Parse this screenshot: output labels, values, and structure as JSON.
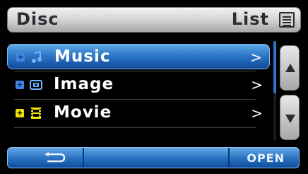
{
  "header": {
    "left_title": "Disc",
    "right_title": "List"
  },
  "list": {
    "items": [
      {
        "label": "Music",
        "icon": "music-note-icon",
        "chevron": ">",
        "selected": true
      },
      {
        "label": "Image",
        "icon": "image-icon",
        "chevron": ">",
        "selected": false
      },
      {
        "label": "Movie",
        "icon": "film-icon",
        "chevron": ">",
        "selected": false
      }
    ]
  },
  "footer": {
    "open_label": "OPEN"
  },
  "colors": {
    "accent_blue": "#2d78c7",
    "expand_blue": "#3e86e6",
    "expand_yellow": "#f2e300"
  }
}
